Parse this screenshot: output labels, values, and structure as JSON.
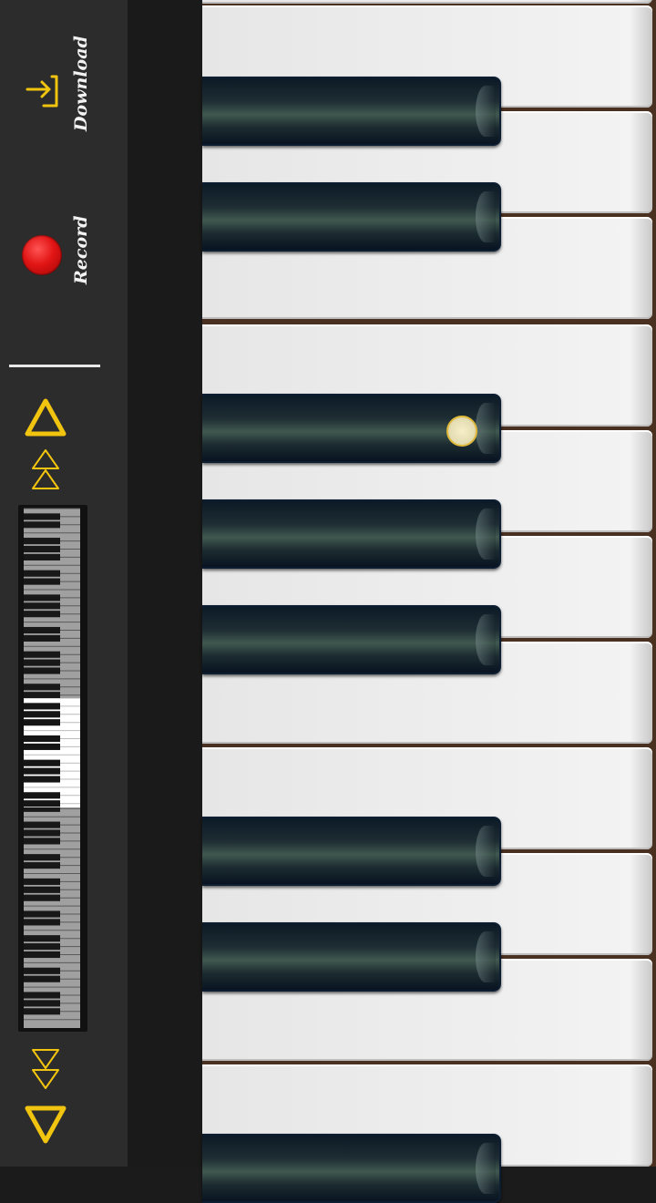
{
  "sidebar": {
    "download": {
      "label": "Download",
      "icon": "download-icon"
    },
    "record": {
      "label": "Record",
      "icon": "record-icon"
    },
    "navigation": {
      "scroll_up_icon": "triangle-up-icon",
      "fast_scroll_up_icon": "double-triangle-up-icon",
      "fast_scroll_down_icon": "double-triangle-down-icon",
      "scroll_down_icon": "triangle-down-icon"
    }
  },
  "colors": {
    "accent": "#f1c40f",
    "record": "#e11414",
    "sidebar_bg": "#2c2c2c"
  },
  "piano": {
    "orientation": "vertical",
    "visible_white_keys": 11,
    "visible_black_keys": 8,
    "pressed_key": "black-key-3"
  }
}
